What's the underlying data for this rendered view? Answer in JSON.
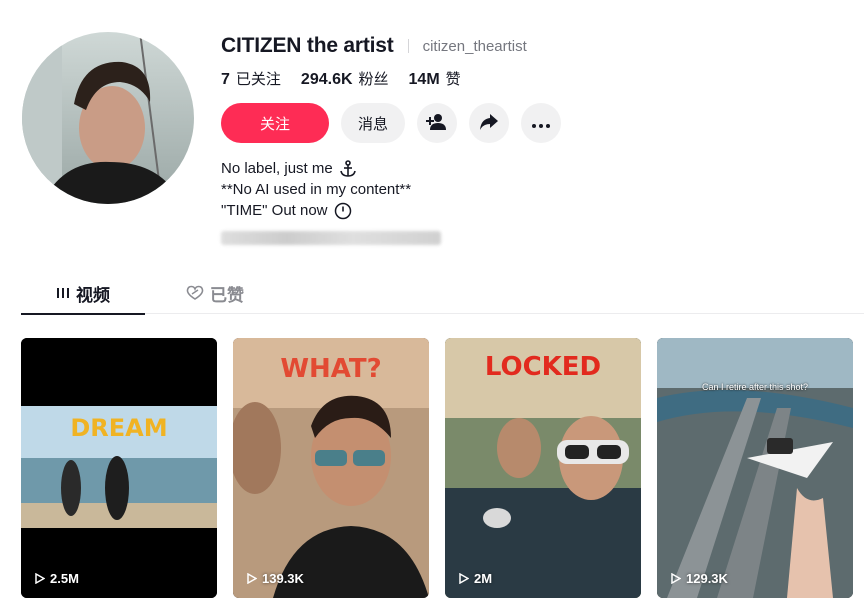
{
  "profile": {
    "display_name": "CITIZEN the artist",
    "username": "citizen_theartist"
  },
  "stats": [
    {
      "value": "7",
      "label": "已关注"
    },
    {
      "value": "294.6K",
      "label": "粉丝"
    },
    {
      "value": "14M",
      "label": "赞"
    }
  ],
  "actions": {
    "follow_label": "关注",
    "message_label": "消息"
  },
  "bio": {
    "line1": "No label, just me",
    "line2": "**No AI used in my content**",
    "line3": "\"TIME\" Out now"
  },
  "tabs": [
    {
      "label": "视频",
      "icon": "grid-icon",
      "active": true
    },
    {
      "label": "已赞",
      "icon": "heart-outline-icon",
      "active": false
    }
  ],
  "videos": [
    {
      "title": "DREAM",
      "views": "2.5M"
    },
    {
      "title": "WHAT?",
      "views": "139.3K"
    },
    {
      "title": "LOCKED",
      "views": "2M"
    },
    {
      "title": "",
      "caption": "Can I retire after this shot?",
      "views": "129.3K"
    }
  ],
  "colors": {
    "accent": "#fe2c55",
    "text": "#161823",
    "muted": "#75777f"
  }
}
